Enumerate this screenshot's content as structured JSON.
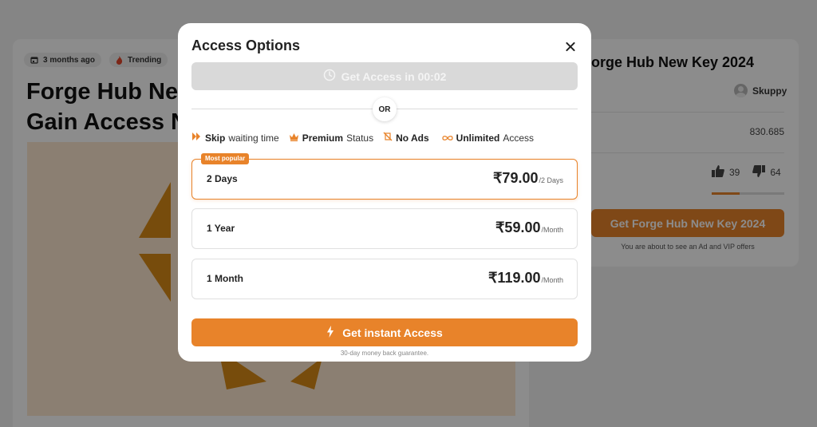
{
  "background": {
    "date_chip": "3 months ago",
    "trending_chip": "Trending",
    "title_line1": "Forge Hub New Key 2024:",
    "title_line2": "Gain Access Now",
    "side_title": "Forge Hub New Key 2024",
    "author": "Skuppy",
    "views": "830.685",
    "likes": "39",
    "dislikes": "64",
    "like_ratio": 0.38,
    "cta_label": "Get Forge Hub New Key 2024",
    "cta_note": "You are about to see an Ad and VIP offers",
    "accent": "#e8832a"
  },
  "modal": {
    "title": "Access Options",
    "timer_label": "Get Access in 00:02",
    "or_label": "OR",
    "features": [
      {
        "icon": "skip-icon",
        "bold": "Skip",
        "text": " waiting time"
      },
      {
        "icon": "crown-icon",
        "bold": "Premium",
        "text": " Status"
      },
      {
        "icon": "no-ads-icon",
        "bold": "No Ads",
        "text": ""
      },
      {
        "icon": "infinity-icon",
        "bold": "Unlimited",
        "text": " Access"
      }
    ],
    "plans": [
      {
        "name": "2 Days",
        "price": "₹79.00",
        "unit": "/2 Days",
        "badge": "Most popular",
        "selected": true
      },
      {
        "name": "1 Year",
        "price": "₹59.00",
        "unit": "/Month",
        "selected": false
      },
      {
        "name": "1 Month",
        "price": "₹119.00",
        "unit": "/Month",
        "selected": false
      }
    ],
    "cta_label": "Get instant Access",
    "guarantee": "30-day money back guarantee."
  }
}
